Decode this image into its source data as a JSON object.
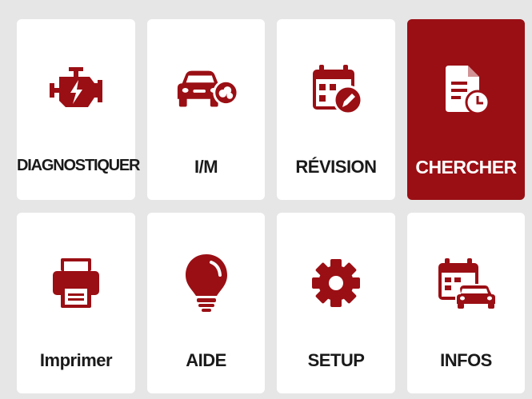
{
  "colors": {
    "accent": "#9a0f14",
    "tile_bg": "#ffffff",
    "page_bg": "#e6e6e6",
    "label_text": "#1a1a1a",
    "active_label_text": "#ffffff"
  },
  "menu": {
    "tiles": [
      {
        "label": "DIAGNOSTIQUER",
        "icon": "engine-icon",
        "active": false
      },
      {
        "label": "I/M",
        "icon": "car-emission-icon",
        "active": false
      },
      {
        "label": "RÉVISION",
        "icon": "calendar-edit-icon",
        "active": false
      },
      {
        "label": "CHERCHER",
        "icon": "document-clock-icon",
        "active": true
      },
      {
        "label": "Imprimer",
        "icon": "printer-icon",
        "active": false
      },
      {
        "label": "AIDE",
        "icon": "lightbulb-icon",
        "active": false
      },
      {
        "label": "SETUP",
        "icon": "gear-icon",
        "active": false
      },
      {
        "label": "INFOS",
        "icon": "calendar-car-icon",
        "active": false
      }
    ]
  }
}
